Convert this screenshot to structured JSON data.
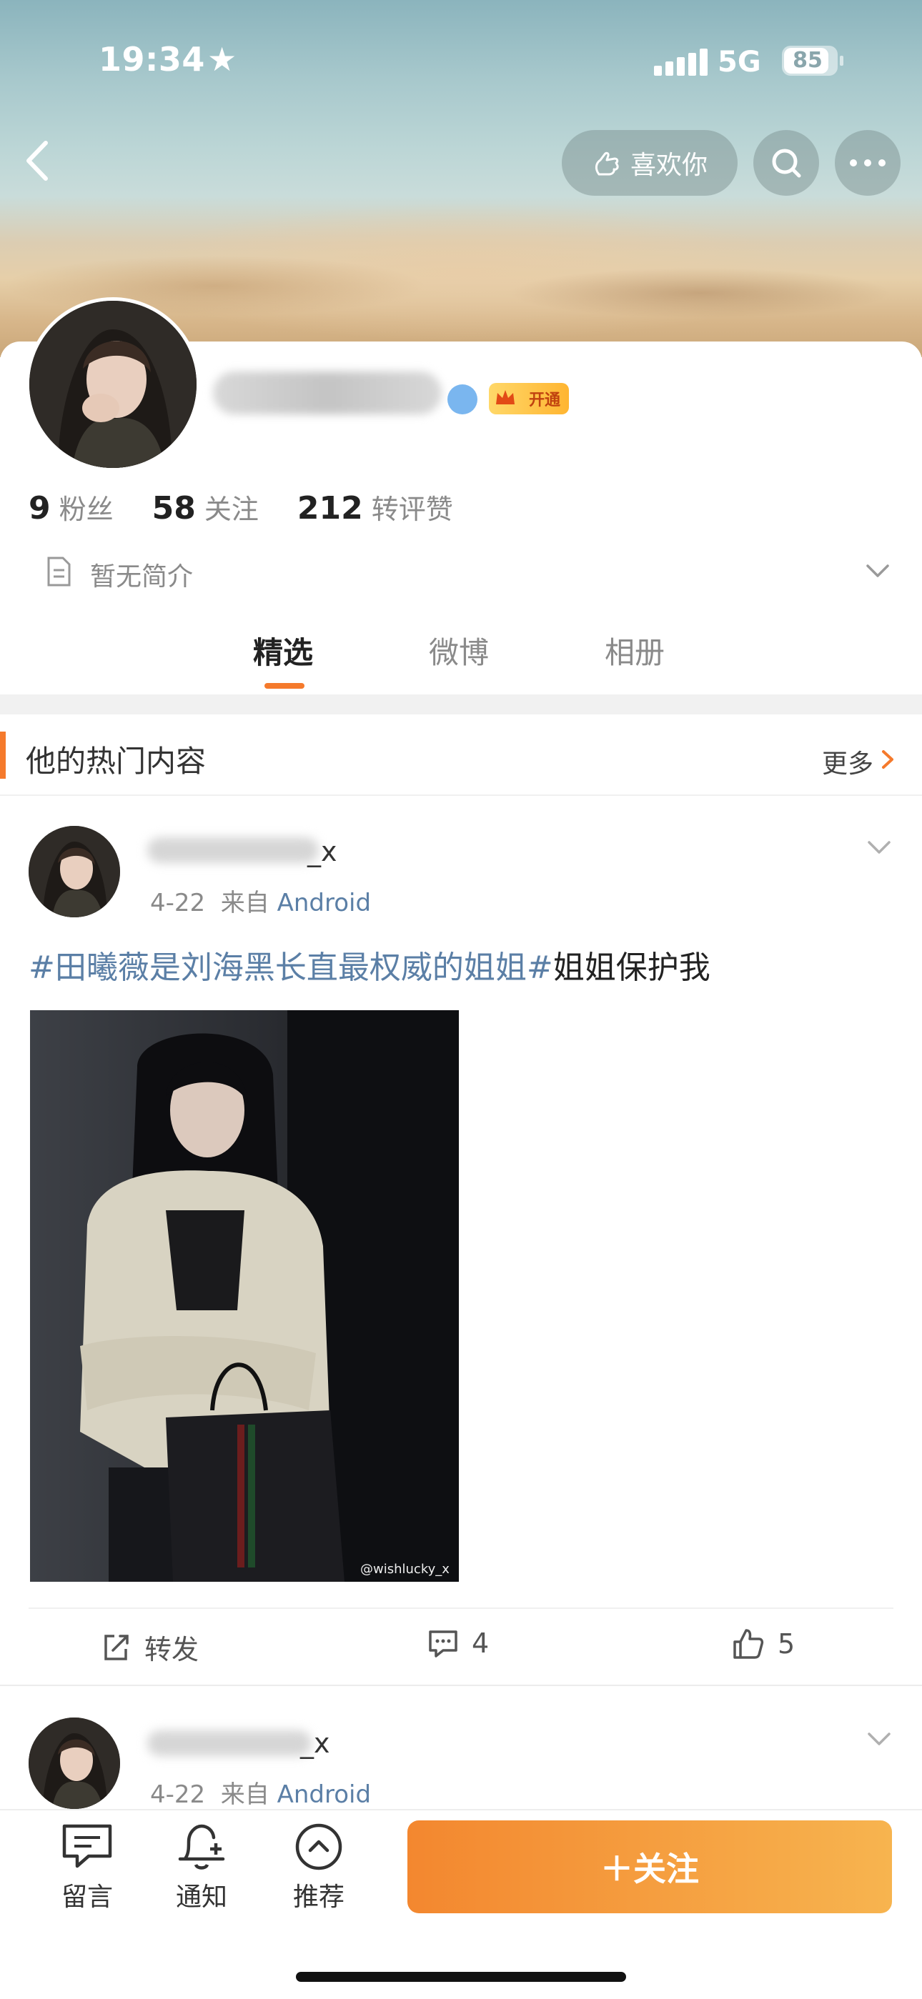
{
  "status_bar": {
    "time": "19:34",
    "network": "5G",
    "battery": "85"
  },
  "header": {
    "like_label": "喜欢你"
  },
  "profile": {
    "username_suffix": "_x",
    "vip_label": "开通",
    "stats": [
      {
        "value": "9",
        "label": "粉丝"
      },
      {
        "value": "58",
        "label": "关注"
      },
      {
        "value": "212",
        "label": "转评赞"
      }
    ],
    "bio": "暂无简介"
  },
  "tabs": [
    {
      "label": "精选",
      "active": true
    },
    {
      "label": "微博",
      "active": false
    },
    {
      "label": "相册",
      "active": false
    }
  ],
  "section": {
    "title": "他的热门内容",
    "more_label": "更多"
  },
  "posts": [
    {
      "username_suffix": "_x",
      "date": "4-22",
      "source_prefix": "来自",
      "source": "Android",
      "text_tag": "#田曦薇是刘海黑长直最权威的姐姐#",
      "text_rest": "姐姐保护我",
      "watermark": "@wishlucky_x",
      "repost_label": "转发",
      "comment_count": "4",
      "like_count": "5"
    },
    {
      "username_suffix": "_x",
      "date": "4-22",
      "source_prefix": "来自",
      "source": "Android"
    }
  ],
  "bottom_bar": {
    "items": [
      {
        "label": "留言",
        "icon": "message-icon"
      },
      {
        "label": "通知",
        "icon": "bell-plus-icon"
      },
      {
        "label": "推荐",
        "icon": "chevron-up-circle-icon"
      }
    ],
    "follow_label": "＋关注"
  },
  "colors": {
    "accent": "#f57a2c",
    "link": "#5b7fa6",
    "follow_start": "#f3872f",
    "follow_end": "#f7b44f"
  }
}
